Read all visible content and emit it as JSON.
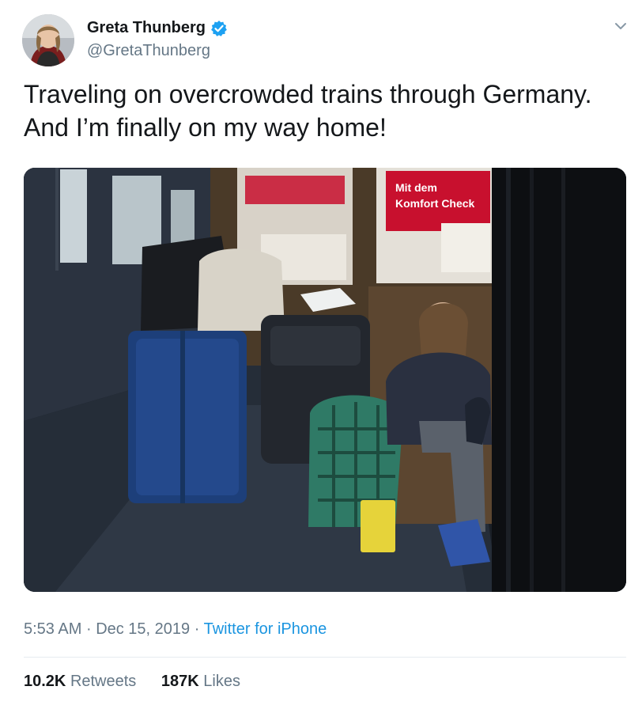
{
  "author": {
    "display_name": "Greta Thunberg",
    "handle": "@GretaThunberg",
    "verified": true,
    "avatar_icon": "profile-photo"
  },
  "tweet": {
    "text_lines": [
      "Traveling on overcrowded trains through Germany.",
      "And I’m finally on my way home!"
    ],
    "photo": {
      "poster_line1": "Mit dem",
      "poster_line2": "Komfort Check"
    },
    "time": "5:53 AM",
    "separator": "·",
    "date": "Dec 15, 2019",
    "source": "Twitter for iPhone"
  },
  "stats": {
    "retweets_count": "10.2K",
    "retweets_label": "Retweets",
    "likes_count": "187K",
    "likes_label": "Likes"
  },
  "colors": {
    "verified_blue": "#1da1f2",
    "link_blue": "#1b95e0",
    "secondary_text": "#657786",
    "poster_red": "#c8102e"
  },
  "icons": {
    "menu": "chevron-down-icon",
    "verified": "verified-badge-icon"
  }
}
